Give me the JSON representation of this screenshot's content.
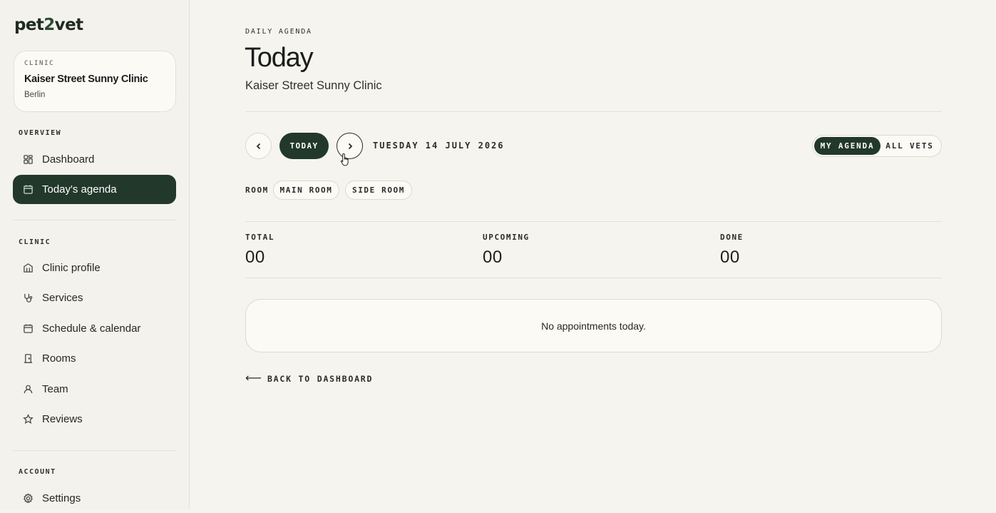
{
  "brand": {
    "logo_pre": "pet",
    "logo_two": "2",
    "logo_post": "vet"
  },
  "clinic_card": {
    "eyebrow": "CLINIC",
    "name": "Kaiser Street Sunny Clinic",
    "city": "Berlin"
  },
  "sidebar": {
    "overview_label": "OVERVIEW",
    "overview_items": [
      {
        "label": "Dashboard",
        "icon": "grid-icon"
      },
      {
        "label": "Today's agenda",
        "icon": "calendar-icon",
        "active": true
      }
    ],
    "clinic_label": "CLINIC",
    "clinic_items": [
      {
        "label": "Clinic profile",
        "icon": "building-icon"
      },
      {
        "label": "Services",
        "icon": "stethoscope-icon"
      },
      {
        "label": "Schedule & calendar",
        "icon": "calendar-icon"
      },
      {
        "label": "Rooms",
        "icon": "door-icon"
      },
      {
        "label": "Team",
        "icon": "user-icon"
      },
      {
        "label": "Reviews",
        "icon": "star-icon"
      }
    ],
    "account_label": "ACCOUNT",
    "account_items": [
      {
        "label": "Settings",
        "icon": "gear-icon"
      }
    ]
  },
  "header": {
    "eyebrow": "DAILY AGENDA",
    "title": "Today",
    "subtitle": "Kaiser Street Sunny Clinic"
  },
  "date_nav": {
    "today_label": "TODAY",
    "date_text": "TUESDAY 14 JULY 2026"
  },
  "view_toggle": {
    "my_agenda": "MY AGENDA",
    "all_vets": "ALL VETS"
  },
  "rooms": {
    "label": "ROOM",
    "options": [
      "MAIN ROOM",
      "SIDE ROOM"
    ]
  },
  "stats": [
    {
      "label": "TOTAL",
      "value": "00"
    },
    {
      "label": "UPCOMING",
      "value": "00"
    },
    {
      "label": "DONE",
      "value": "00"
    }
  ],
  "empty_state": "No appointments today.",
  "back_link": "BACK TO DASHBOARD",
  "colors": {
    "accent": "#22382b",
    "background": "#f5f4ef",
    "card": "#fbfaf5"
  }
}
